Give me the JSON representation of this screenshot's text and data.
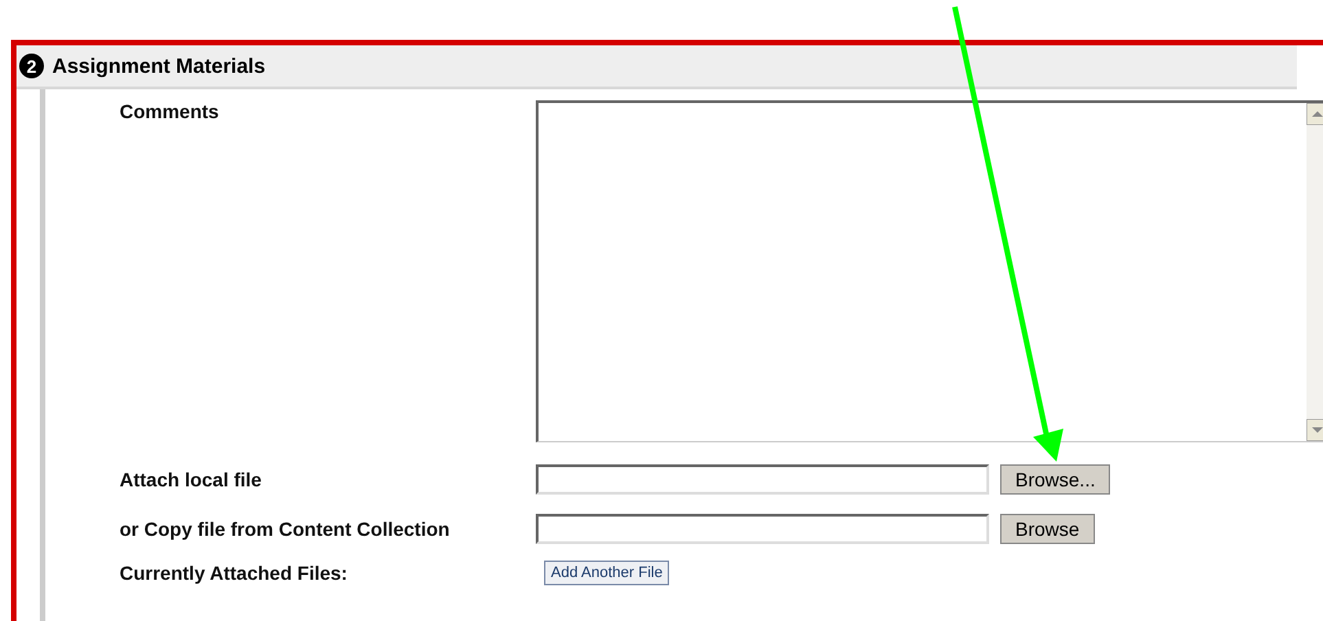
{
  "section": {
    "step": "2",
    "title": "Assignment Materials"
  },
  "comments": {
    "label": "Comments"
  },
  "rows": [
    {
      "kind": "file",
      "label": "Attach local file",
      "button": "Browse..."
    },
    {
      "kind": "file",
      "label": "or Copy file from Content Collection",
      "button": "Browse"
    },
    {
      "kind": "action",
      "label": "Currently Attached Files:",
      "button": "Add Another File"
    }
  ]
}
